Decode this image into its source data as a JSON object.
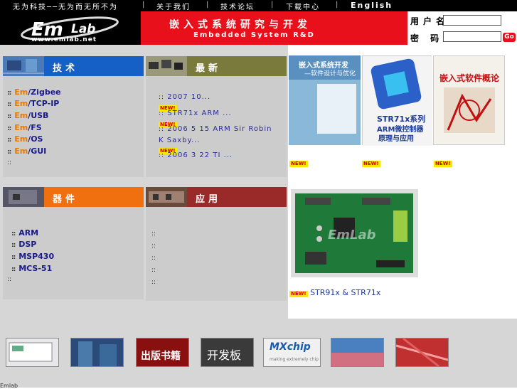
{
  "topnav": {
    "slogan": "无为科技──无为而无所不为",
    "about": "关于我们",
    "forum": "技术论坛",
    "download": "下载中心",
    "english": "English",
    "sep": "|"
  },
  "logo": {
    "text": "www.emlab.net",
    "brand": "EmLab"
  },
  "banner": {
    "cn": "嵌入式系统研究与开发",
    "en": "Embedded System R&D"
  },
  "login": {
    "username_label": "用户名",
    "password_label": "密  码",
    "go": "Go"
  },
  "panels": {
    "tech": {
      "title": "技术",
      "color": "#1560c6",
      "items": [
        {
          "prefix": "Em",
          "suffix": "/Zigbee"
        },
        {
          "prefix": "Em",
          "suffix": "/TCP-IP"
        },
        {
          "prefix": "Em",
          "suffix": "/USB"
        },
        {
          "prefix": "Em",
          "suffix": "/FS"
        },
        {
          "prefix": "Em",
          "suffix": "/OS"
        },
        {
          "prefix": "Em",
          "suffix": "/GUI"
        }
      ]
    },
    "news": {
      "title": "最新",
      "color": "#7a7a3c",
      "badge": "NEW!",
      "items": [
        "2007 10...",
        "STR71x  ARM          ...",
        "2006 5 15  ARM  Sir Robin K Saxby...",
        "2006 3 22        TI      ..."
      ]
    },
    "devices": {
      "title": "器件",
      "color": "#f07010",
      "items": [
        "ARM",
        "DSP",
        "MSP430",
        "MCS-51"
      ]
    },
    "apps": {
      "title": "应用",
      "color": "#9a2a2a"
    }
  },
  "books": {
    "b1_title": "嵌入式系统开发",
    "b1_sub": "—软件设计与优化",
    "b2_title": "STR71x系列",
    "b2_sub": "ARM微控制器",
    "b2_sub2": "原理与应用",
    "b3_title": "嵌入式软件概论",
    "badge": "NEW!"
  },
  "board": {
    "caption": "STR91x & STR71x",
    "badge": "NEW!",
    "watermark": "EmLab"
  },
  "thumbs": {
    "books_label": "出版书籍",
    "devboard_label": "开发板",
    "mxchip": "MXchip",
    "mxchip_sub": "making extremely chip"
  },
  "bottom": {
    "text": "Emlab"
  }
}
